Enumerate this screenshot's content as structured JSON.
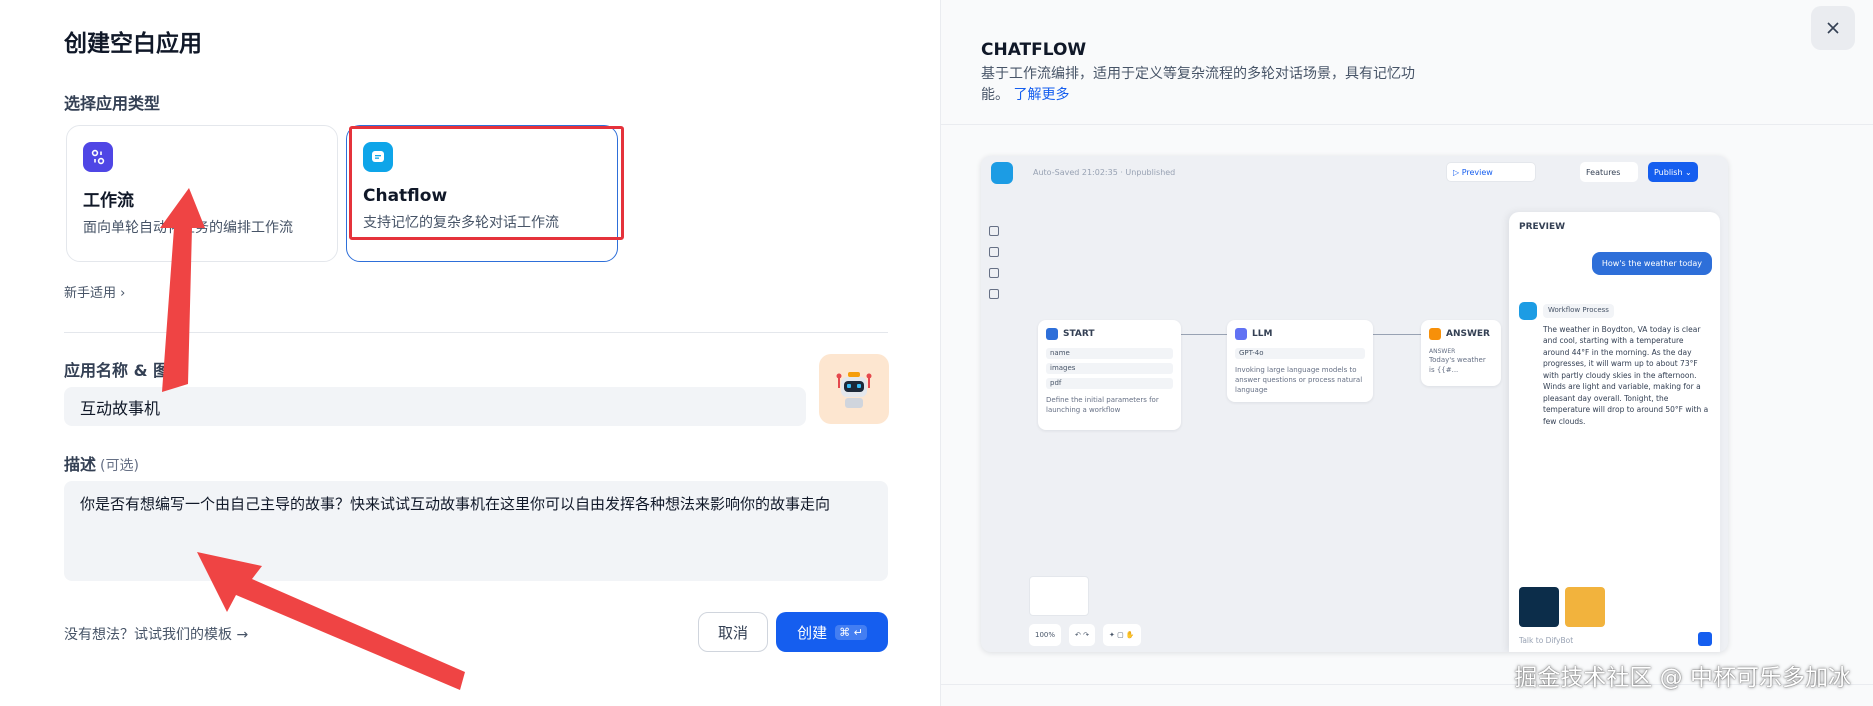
{
  "dialog": {
    "title": "创建空白应用",
    "type_section_label": "选择应用类型",
    "app_types": [
      {
        "title": "工作流",
        "description": "面向单轮自动化任务的编排工作流",
        "icon": "workflow-icon"
      },
      {
        "title": "Chatflow",
        "description": "支持记忆的复杂多轮对话工作流",
        "icon": "chatflow-icon"
      }
    ],
    "newbie_label": "新手适用",
    "name_section_label": "应用名称 & 图",
    "name_value": "互动故事机",
    "desc_section_label": "描述",
    "desc_optional": "(可选)",
    "desc_value": "你是否有想编写一个由自己主导的故事？快来试试互动故事机在这里你可以自由发挥各种想法来影响你的故事走向",
    "template_link": "没有想法？试试我们的模板 →",
    "cancel_label": "取消",
    "create_label": "创建",
    "create_shortcut": "⌘ ↵"
  },
  "info": {
    "title": "CHATFLOW",
    "description": "基于工作流编排，适用于定义等复杂流程的多轮对话场景，具有记忆功能。",
    "learn_more": "了解更多"
  },
  "preview": {
    "autosave": "Auto-Saved 21:02:35 · Unpublished",
    "preview_btn": "▷ Preview",
    "features_btn": "Features",
    "publish_btn": "Publish ⌄",
    "panel_title": "PREVIEW",
    "user_msg": "How's the weather today",
    "workflow_tag": "Workflow Process",
    "reply": "The weather in Boydton, VA today is clear and cool, starting with a temperature around 44°F in the morning. As the day progresses, it will warm up to about 73°F with partly cloudy skies in the afternoon. Winds are light and variable, making for a pleasant day overall. Tonight, the temperature will drop to around 50°F with a few clouds.",
    "input_placeholder": "Talk to DifyBot",
    "zoom": "100%",
    "nodes": {
      "start": {
        "title": "START",
        "rows": [
          "name",
          "images",
          "pdf"
        ],
        "note": "Define the initial parameters for launching a workflow"
      },
      "llm": {
        "title": "LLM",
        "model": "GPT-4o",
        "note": "Invoking large language models to answer questions or process natural language"
      },
      "answer": {
        "title": "ANSWER",
        "label": "ANSWER",
        "note": "Today's weather is {{#..."
      }
    }
  },
  "watermark": "掘金技术社区 @ 中杯可乐多加冰",
  "colors": {
    "accent": "#155eef",
    "highlight": "#e5323b",
    "arrow": "#ef4444"
  }
}
